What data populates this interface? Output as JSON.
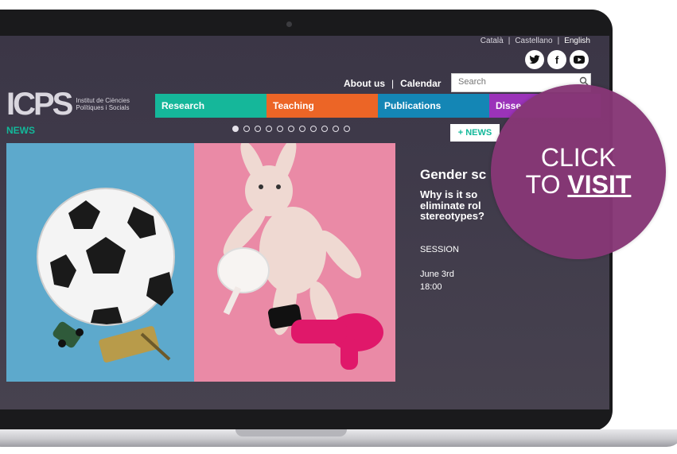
{
  "languages": [
    {
      "label": "Català",
      "active": false
    },
    {
      "label": "Castellano",
      "active": false
    },
    {
      "label": "English",
      "active": true
    }
  ],
  "socials": [
    {
      "icon": "twitter-icon",
      "glyph": "t"
    },
    {
      "icon": "facebook-icon",
      "glyph": "f"
    },
    {
      "icon": "youtube-icon",
      "glyph": "▶"
    }
  ],
  "top_links": {
    "about": "About us",
    "calendar": "Calendar"
  },
  "search": {
    "placeholder": "Search"
  },
  "logo": {
    "mark": "ICPS",
    "line1": "Institut de Ciències",
    "line2": "Polítiques i Socials"
  },
  "nav": {
    "research": "Research",
    "teaching": "Teaching",
    "publications": "Publications",
    "disse": "Disse"
  },
  "news": {
    "label": "NEWS",
    "more_button": "+ NEWS",
    "slide_count": 11,
    "active_slide": 1
  },
  "feature": {
    "title": "Gender sc",
    "subtitle_line1": "Why is it so",
    "subtitle_line2": "eliminate rol",
    "subtitle_line3": "stereotypes?",
    "type": "SESSION",
    "date": "June 3rd",
    "time": "18:00"
  },
  "cta": {
    "line1": "CLICK",
    "line2_prefix": "TO ",
    "line2_strong": "VISIT",
    "color": "#863776"
  },
  "colors": {
    "research": "#15b79a",
    "teaching": "#ec6526",
    "publications": "#1486b5",
    "disse": "#9b33b9",
    "news_accent": "#13b89a"
  }
}
